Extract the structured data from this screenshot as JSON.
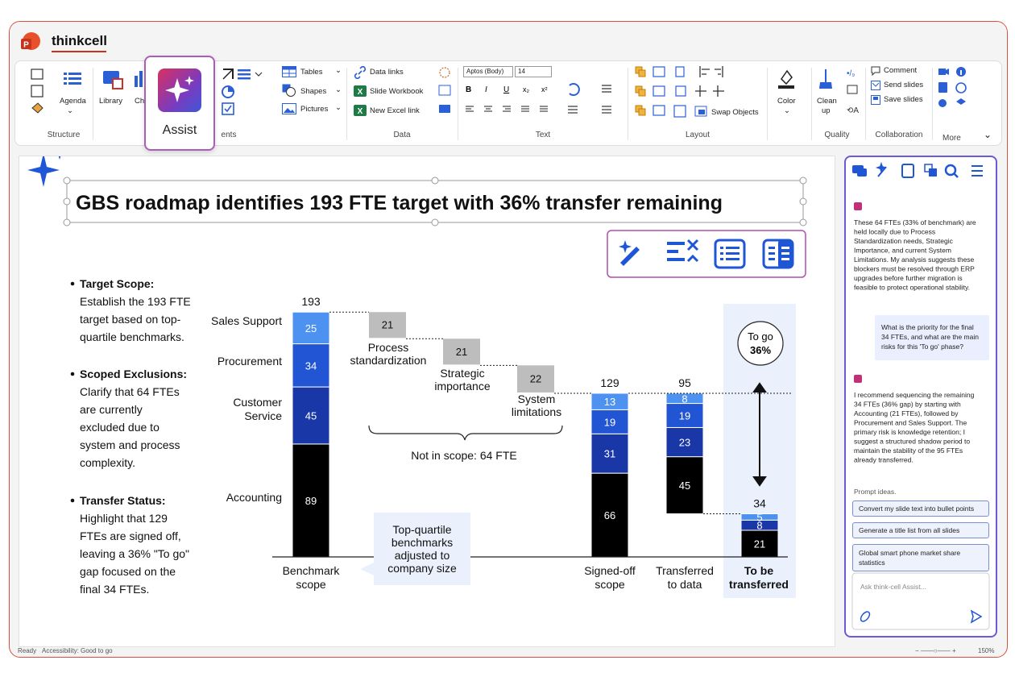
{
  "app": {
    "title": "thinkcell"
  },
  "ribbon": {
    "assist_label": "Assist",
    "structure": {
      "agenda": "Agenda",
      "label": "Structure"
    },
    "library": "Library",
    "chart_label": "Cha",
    "elements_label": "ents",
    "tables": "Tables",
    "shapes": "Shapes",
    "pictures": "Pictures",
    "data": {
      "links": "Data links",
      "workbook": "Slide Workbook",
      "excel": "New Excel link",
      "label": "Data"
    },
    "text": {
      "font": "Aptos (Body)",
      "size": "14",
      "label": "Text"
    },
    "layout": {
      "swap": "Swap Objects",
      "label": "Layout"
    },
    "color": "Color",
    "quality": {
      "clean": "Clean",
      "up": "up",
      "label": "Quality"
    },
    "collab": {
      "comment": "Comment",
      "send": "Send slides",
      "save": "Save slides",
      "label": "Collaboration"
    },
    "more": "More"
  },
  "slide": {
    "title": "GBS roadmap identifies 193 FTE target with 36% transfer remaining",
    "bullets": [
      {
        "head": "Target Scope:",
        "l1": "Establish the 193 FTE",
        "l2": "target based on top-",
        "l3": "quartile benchmarks.",
        "l4": "",
        "l5": ""
      },
      {
        "head": "Scoped Exclusions:",
        "l1": "Clarify that 64 FTEs",
        "l2": "are currently",
        "l3": "excluded due to",
        "l4": "system and process",
        "l5": "complexity."
      },
      {
        "head": "Transfer Status:",
        "l1": "Highlight that 129",
        "l2": "FTEs are signed off,",
        "l3": "leaving a 36% \"To go\"",
        "l4": "gap focused on the",
        "l5": "final 34 FTEs."
      }
    ]
  },
  "chart_data": {
    "type": "waterfall",
    "segments": [
      "Sales Support",
      "Procurement",
      "Customer Service",
      "Accounting"
    ],
    "colors": [
      "#4d92f0",
      "#2255d4",
      "#1a37a8",
      "#000000"
    ],
    "bars": [
      {
        "category": "Benchmark scope",
        "total": 193,
        "values": [
          25,
          34,
          45,
          89
        ]
      },
      {
        "category": "Signed-off scope",
        "total": 129,
        "values": [
          13,
          19,
          31,
          66
        ]
      },
      {
        "category": "Transferred to data",
        "total": 95,
        "values": [
          8,
          19,
          23,
          45
        ]
      },
      {
        "category": "To be transferred",
        "total": 34,
        "values": [
          5,
          8,
          21
        ]
      }
    ],
    "steps": [
      {
        "label": "Process standardization",
        "l1": "Process",
        "l2": "standardization",
        "value": 21
      },
      {
        "label": "Strategic importance",
        "l1": "Strategic",
        "l2": "importance",
        "value": 21
      },
      {
        "label": "System limitations",
        "l1": "System",
        "l2": "limitations",
        "value": 22
      }
    ],
    "labels": {
      "seg_sales": "Sales Support",
      "seg_proc": "Procurement",
      "seg_cust1": "Customer",
      "seg_cust2": "Service",
      "seg_acc": "Accounting",
      "cat1a": "Benchmark",
      "cat1b": "scope",
      "cat2a": "Signed-off",
      "cat2b": "scope",
      "cat3a": "Transferred",
      "cat3b": "to data",
      "cat4a": "To be",
      "cat4b": "transferred"
    },
    "not_in_scope": "Not in scope: 64 FTE",
    "callout": {
      "l1": "Top-quartile",
      "l2": "benchmarks",
      "l3": "adjusted to",
      "l4": "company size"
    },
    "togo": {
      "l1": "To go",
      "l2": "36%"
    }
  },
  "panel": {
    "msg1": [
      "These 64 FTEs (33% of benchmark) are",
      "held locally due to Process",
      "Standardization needs, Strategic",
      "Importance, and current System",
      "Limitations. My analysis suggests these",
      "blockers must be resolved through ERP",
      "upgrades before further migration is",
      "feasible to protect operational stability."
    ],
    "user_msg": [
      "What is the priority for the final",
      "34 FTEs, and what are the main",
      "risks for this 'To go' phase?"
    ],
    "msg2": [
      "I recommend sequencing the remaining",
      "34 FTEs (36% gap) by starting with",
      "Accounting (21 FTEs), followed by",
      "Procurement and Sales Support. The",
      "primary risk is knowledge retention; I",
      "suggest a structured shadow period to",
      "maintain the stability of the 95 FTEs",
      "already transferred."
    ],
    "prompt_ideas": "Prompt ideas.",
    "chips": [
      "Convert my slide text into bullet points",
      "Generate a title list from all slides",
      "Global smart phone market share statistics"
    ],
    "placeholder": "Ask think-cell Assist..."
  },
  "status": {
    "ready": "Ready",
    "accessibility": "Accessibility: Good to go",
    "zoom": "150%"
  }
}
